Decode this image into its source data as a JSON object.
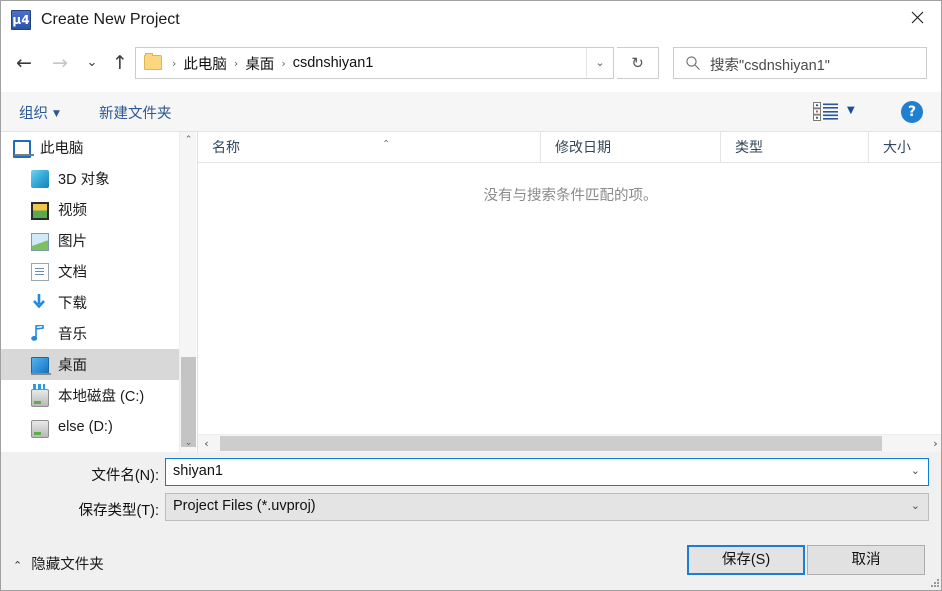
{
  "window": {
    "title": "Create New Project",
    "app_icon": "uvision-icon",
    "close_label": "✕"
  },
  "nav": {
    "back_icon": "←",
    "forward_icon": "→",
    "recent_icon": "⌄",
    "up_icon": "↑",
    "refresh_icon": "↻",
    "address_dropdown_icon": "⌄",
    "breadcrumbs": [
      {
        "label": "此电脑"
      },
      {
        "label": "桌面"
      },
      {
        "label": "csdnshiyan1"
      }
    ],
    "separator": "›"
  },
  "search": {
    "placeholder": "搜索\"csdnshiyan1\""
  },
  "toolbar": {
    "organize_label": "组织",
    "organize_caret": "▼",
    "new_folder_label": "新建文件夹",
    "view_caret": "▼",
    "help_label": "?"
  },
  "sidebar": {
    "items": [
      {
        "label": "此电脑",
        "icon": "this-pc-icon",
        "level": 1,
        "selected": false
      },
      {
        "label": "3D 对象",
        "icon": "3d-objects-icon",
        "level": 2,
        "selected": false
      },
      {
        "label": "视频",
        "icon": "videos-icon",
        "level": 2,
        "selected": false
      },
      {
        "label": "图片",
        "icon": "pictures-icon",
        "level": 2,
        "selected": false
      },
      {
        "label": "文档",
        "icon": "documents-icon",
        "level": 2,
        "selected": false
      },
      {
        "label": "下载",
        "icon": "downloads-icon",
        "level": 2,
        "selected": false
      },
      {
        "label": "音乐",
        "icon": "music-icon",
        "level": 2,
        "selected": false
      },
      {
        "label": "桌面",
        "icon": "desktop-icon",
        "level": 2,
        "selected": true
      },
      {
        "label": "本地磁盘 (C:)",
        "icon": "system-drive-icon",
        "level": 2,
        "selected": false
      },
      {
        "label": "else (D:)",
        "icon": "drive-icon",
        "level": 2,
        "selected": false
      }
    ],
    "scroll_up_icon": "⌃",
    "scroll_down_icon": "⌄"
  },
  "filelist": {
    "columns": [
      {
        "label": "名称"
      },
      {
        "label": "修改日期"
      },
      {
        "label": "类型"
      },
      {
        "label": "大小"
      }
    ],
    "sort_caret": "⌃",
    "empty_message": "没有与搜索条件匹配的项。",
    "rows": [],
    "hscroll_left_icon": "‹",
    "hscroll_right_icon": "›"
  },
  "form": {
    "filename_label": "文件名(N):",
    "filename_value": "shiyan1",
    "filetype_label": "保存类型(T):",
    "filetype_value": "Project Files (*.uvproj)",
    "dropdown_icon": "⌄"
  },
  "footer": {
    "hide_folders_caret": "⌃",
    "hide_folders_label": "隐藏文件夹",
    "save_label": "保存(S)",
    "cancel_label": "取消"
  },
  "colors": {
    "accent": "#1a7fd4",
    "link": "#2b5797",
    "selection": "#d8d8d8",
    "dialog_bg": "#f0f0f0"
  }
}
